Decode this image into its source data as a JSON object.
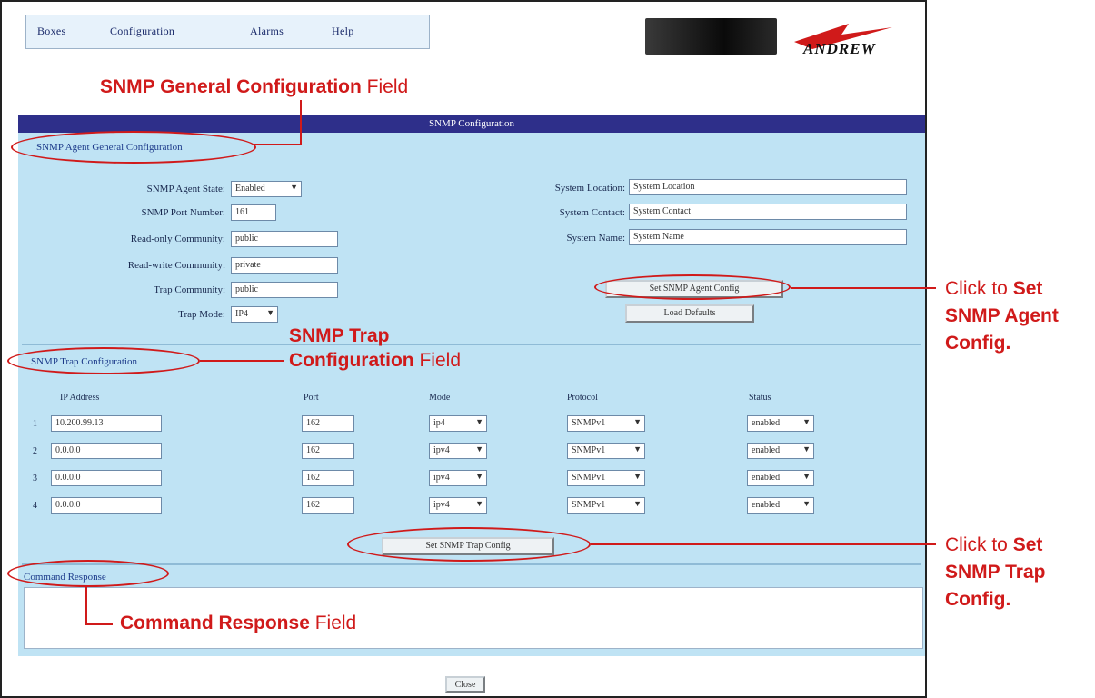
{
  "menu": {
    "items": [
      "Boxes",
      "Configuration",
      "Alarms",
      "Help"
    ]
  },
  "brand": {
    "name": "ANDREW"
  },
  "panel": {
    "title": "SNMP Configuration"
  },
  "agent": {
    "section_title": "SNMP Agent General Configuration",
    "left_fields": [
      {
        "label": "SNMP Agent State:",
        "value": "Enabled",
        "kind": "select"
      },
      {
        "label": "SNMP Port Number:",
        "value": "161",
        "kind": "input"
      },
      {
        "label": "Read-only Community:",
        "value": "public",
        "kind": "input"
      },
      {
        "label": "Read-write Community:",
        "value": "private",
        "kind": "input"
      },
      {
        "label": "Trap Community:",
        "value": "public",
        "kind": "input"
      },
      {
        "label": "Trap Mode:",
        "value": "IP4",
        "kind": "select"
      }
    ],
    "right_fields": [
      {
        "label": "System Location:",
        "value": "System Location"
      },
      {
        "label": "System Contact:",
        "value": "System Contact"
      },
      {
        "label": "System Name:",
        "value": "System Name"
      }
    ],
    "set_button": "Set SNMP Agent Config",
    "defaults_button": "Load Defaults"
  },
  "trap": {
    "section_title": "SNMP Trap Configuration",
    "columns": [
      "IP Address",
      "Port",
      "Mode",
      "Protocol",
      "Status"
    ],
    "rows": [
      {
        "num": "1",
        "ip": "10.200.99.13",
        "port": "162",
        "mode": "ip4",
        "protocol": "SNMPv1",
        "status": "enabled"
      },
      {
        "num": "2",
        "ip": "0.0.0.0",
        "port": "162",
        "mode": "ipv4",
        "protocol": "SNMPv1",
        "status": "enabled"
      },
      {
        "num": "3",
        "ip": "0.0.0.0",
        "port": "162",
        "mode": "ipv4",
        "protocol": "SNMPv1",
        "status": "enabled"
      },
      {
        "num": "4",
        "ip": "0.0.0.0",
        "port": "162",
        "mode": "ipv4",
        "protocol": "SNMPv1",
        "status": "enabled"
      }
    ],
    "set_button": "Set SNMP Trap Config"
  },
  "response": {
    "section_title": "Command Response"
  },
  "footer": {
    "close_button": "Close"
  },
  "annotations": {
    "general_bold": "SNMP General Configuration",
    "general_rest": "Field",
    "trap_line1": "SNMP Trap",
    "trap_bold2": "Configuration",
    "trap_rest": "Field",
    "agent_click_pre": "Click to",
    "agent_click_bold1": "Set",
    "agent_click_bold2": "SNMP Agent",
    "agent_click_bold3": "Config.",
    "trapset_click_pre": "Click to",
    "trapset_click_bold1": "Set",
    "trapset_click_bold2": "SNMP Trap",
    "trapset_click_bold3": "Config.",
    "response_bold": "Command Response",
    "response_rest": "Field"
  },
  "colors": {
    "annotation": "#d01a1a",
    "title_bar": "#2e2f8a",
    "panel": "#bfe3f4"
  }
}
